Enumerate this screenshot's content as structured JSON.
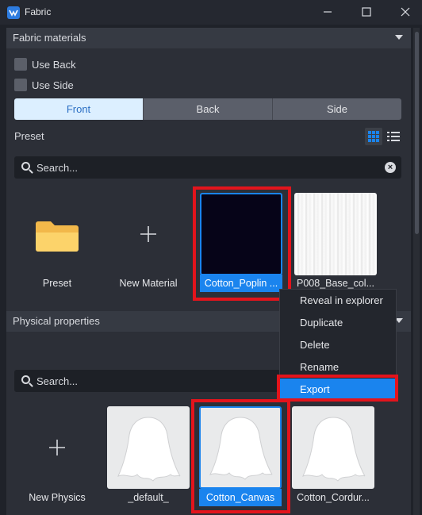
{
  "window": {
    "title": "Fabric",
    "icon": "fabric-app-icon"
  },
  "fabric_materials": {
    "header": "Fabric materials",
    "use_back": "Use Back",
    "use_side": "Use Side",
    "tabs": [
      "Front",
      "Back",
      "Side"
    ],
    "active_tab": "Front",
    "preset_label": "Preset",
    "search_placeholder": "Search...",
    "items": [
      {
        "label": "Preset",
        "icon": "folder-icon"
      },
      {
        "label": "New Material",
        "icon": "plus-icon"
      },
      {
        "label": "Cotton_Poplin ...",
        "selected": true
      },
      {
        "label": "P008_Base_col..."
      }
    ]
  },
  "context_menu": {
    "items": [
      "Reveal in explorer",
      "Duplicate",
      "Delete",
      "Rename",
      "Export"
    ],
    "highlighted": "Export"
  },
  "physical_properties": {
    "header": "Physical properties",
    "search_placeholder": "Search...",
    "items": [
      {
        "label": "New Physics",
        "icon": "plus-icon"
      },
      {
        "label": "_default_"
      },
      {
        "label": "Cotton_Canvas",
        "selected": true
      },
      {
        "label": "Cotton_Cordur..."
      }
    ]
  },
  "colors": {
    "accent": "#1a84ee",
    "highlight_box": "#e3141c",
    "active_tab_bg": "#dcefff"
  }
}
